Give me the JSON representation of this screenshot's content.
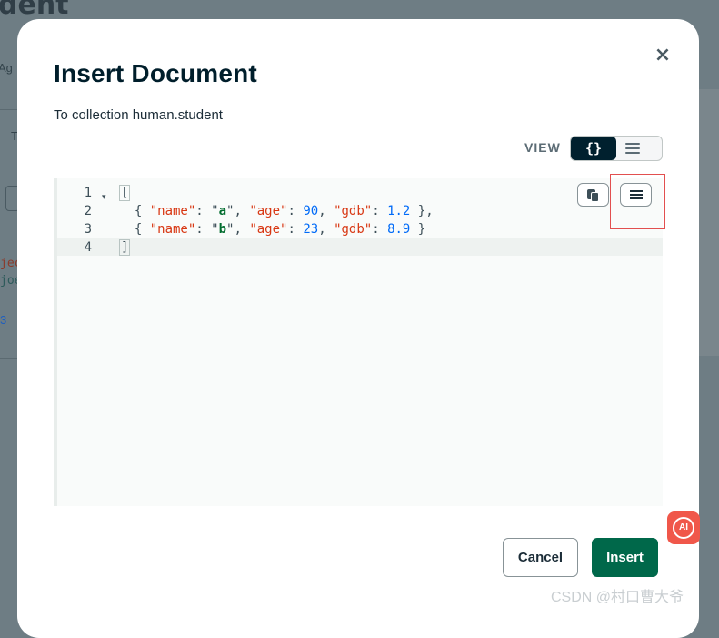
{
  "background": {
    "title_fragment": "dent",
    "frag_ag": "Ag",
    "frag_t": "T",
    "frag_jec": "jec",
    "frag_joe": "joe",
    "frag_3": "3"
  },
  "modal": {
    "title": "Insert Document",
    "subtitle": "To collection human.student",
    "close_icon": "×",
    "view_label": "VIEW",
    "view_json_glyph": "{}",
    "view_json_icon": "curly-braces-icon",
    "view_list_icon": "list-icon"
  },
  "editor": {
    "line_numbers": [
      "1",
      "2",
      "3",
      "4"
    ],
    "fold_glyph": "▾",
    "open_bracket": "[",
    "close_bracket": "]",
    "rows": [
      {
        "name": "a",
        "age": "90",
        "gdb": "1.2",
        "trail": " },"
      },
      {
        "name": "b",
        "age": "23",
        "gdb": "8.9",
        "trail": " }"
      }
    ],
    "keys": {
      "name": "\"name\"",
      "age": "\"age\"",
      "gdb": "\"gdb\""
    },
    "copy_icon": "copy-icon",
    "format_icon": "format-icon"
  },
  "footer": {
    "cancel_label": "Cancel",
    "insert_label": "Insert"
  },
  "ai_badge": {
    "label": "AI"
  },
  "watermark": "CSDN @村口曹大爷",
  "colors": {
    "primary": "#00684a",
    "dark": "#001e2b",
    "key_red": "#d83713",
    "string_green": "#016c2e",
    "number_blue": "#016bf8",
    "highlight_box": "#e24f4f"
  }
}
